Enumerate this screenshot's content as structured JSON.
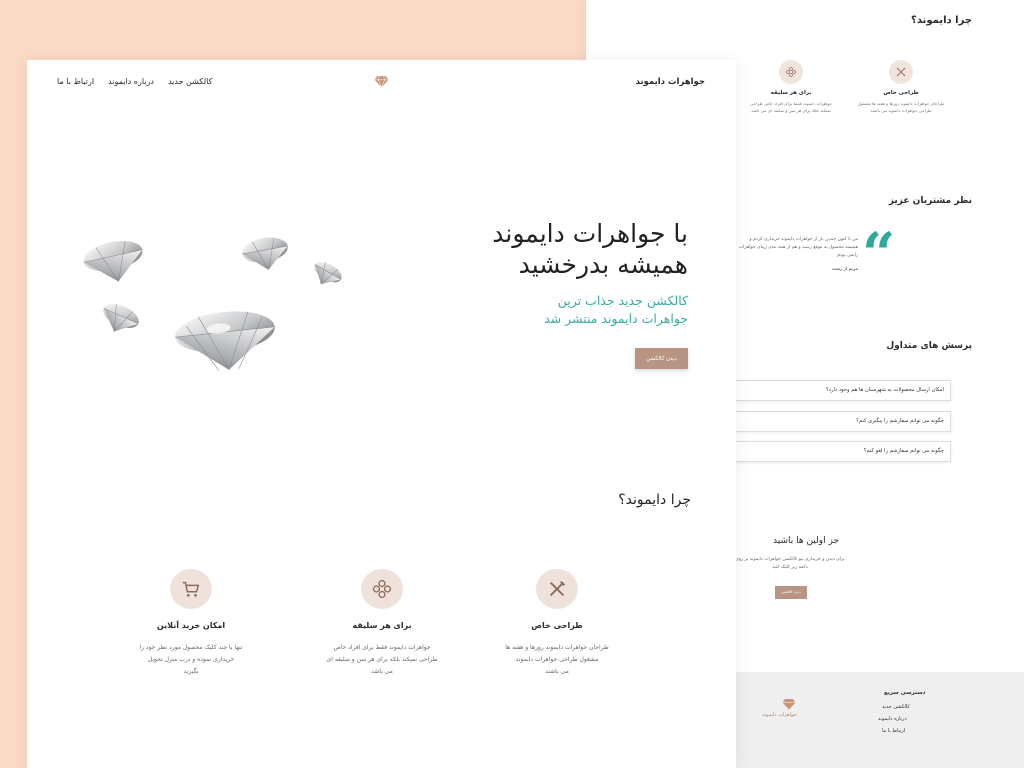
{
  "back": {
    "why_title": "چرا دایموند؟",
    "features": [
      {
        "title": "طراحی خاص",
        "desc": "طراحان جواهرات دایموند روزها و هفته ها مشغول طراحی جواهرات دایموند می باشند",
        "icon": "pencil-ruler-icon"
      },
      {
        "title": "برای هر سلیقه",
        "desc": "جواهرات دایموند فقط برای افراد خاص طراحی نمیکند بلکه برای هر سن و سلیقه ای می باشد",
        "icon": "flower-pattern-icon"
      }
    ],
    "testimonials_title": "نظر مشتریان عزیز",
    "testimonial_text": "من تا کنون چندین بار از جواهرات دایموند خریداری کردم و همیشه محصول به موقع رسید و هم از همه بندی زیبای جواهرات راضی بودم",
    "testimonial_text_partial": "ی کردم و همیشه",
    "testimonial_author": "مریم از رشت",
    "faq_title": "پرسش های متداول",
    "faqs": [
      "امکان ارسال محصولات به شهرستان ها هم وجود دارد؟",
      "چگونه می توانم سفارشم را پیگیری کنم؟",
      "چگونه می توانم سفارشم را لغو کنم؟"
    ],
    "cta_title": "جز اولین ها باشید",
    "cta_desc": "برای دیدن و خریداری نیو کالکشن جواهرات دایموند بر روی دکمه زیر کلیک کنید",
    "cta_button": "دیدن کالکشن",
    "footer_brand": "جواهرات دایموند",
    "footer_links_title": "دسترسی سریع",
    "footer_links": [
      "کالکشن جدید",
      "درباره دایموند",
      "ارتباط با ما"
    ]
  },
  "front": {
    "brand": "جواهرات دایموند",
    "nav": [
      "کالکشن جدید",
      "درباره دایموند",
      "ارتباط با ما"
    ],
    "hero_title_line1": "با جواهرات دایموند",
    "hero_title_line2": "همیشه بدرخشید",
    "hero_sub_line1": "کالکشن جدید جذاب ترین",
    "hero_sub_line2": "جواهرات دایموند منتشر شد",
    "hero_button": "دیدن کالکشن",
    "why_title": "چرا دایموند؟",
    "features": [
      {
        "title": "طراحی خاص",
        "desc_lines": [
          "طراحان جواهرات دایموند روزها و هفته ها",
          "مشغول طراحی جواهرات دایموند",
          "می باشند"
        ],
        "icon": "pencil-ruler-icon"
      },
      {
        "title": "برای هر سلیقه",
        "desc_lines": [
          "جواهرات دایموند فقط برای افراد خاص",
          "طراحی نمیکند بلکه برای هر سن و سلیقه ای",
          "می باشد"
        ],
        "icon": "flower-pattern-icon"
      },
      {
        "title": "امکان خرید آنلاین",
        "desc_lines": [
          "تنها با چند کلیک محصول مورد نظر خود را",
          "خریداری نموده و درب منزل تحویل",
          "بگیرید"
        ],
        "icon": "cart-icon"
      }
    ]
  },
  "colors": {
    "background": "#fbd9c7",
    "accent": "#b89483",
    "teal": "#3aab9d",
    "icon_circle": "#efe2dc"
  }
}
